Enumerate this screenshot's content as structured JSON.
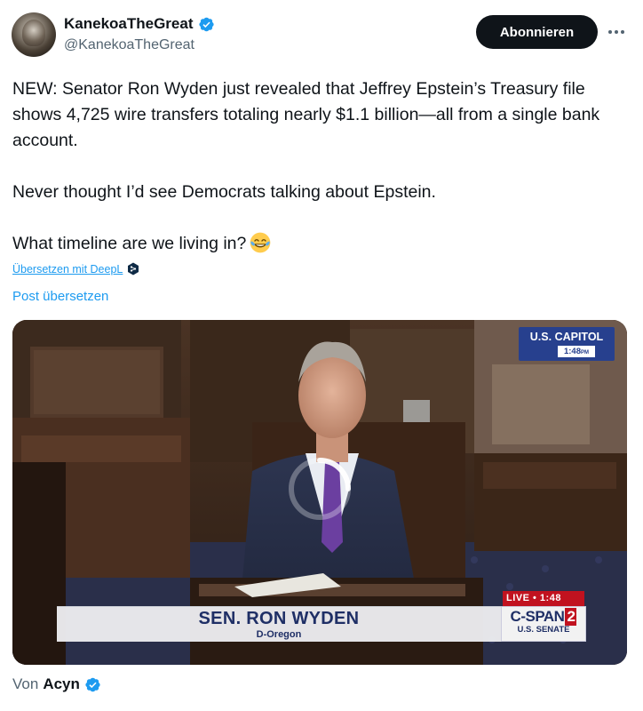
{
  "author": {
    "display_name": "KanekoaTheGreat",
    "handle": "@KanekoaTheGreat"
  },
  "actions": {
    "follow_label": "Abonnieren"
  },
  "tweet": {
    "paragraphs": [
      "NEW: Senator Ron Wyden just revealed that Jeffrey Epstein’s Treasury file shows 4,725 wire transfers totaling nearly $1.1 billion—all from a single bank account.",
      "Never thought I’d see Democrats talking about Epstein.",
      "What timeline are we living in?"
    ],
    "emoji": "face-with-tears-of-joy"
  },
  "translation": {
    "deepl_label": "Übersetzen mit DeepL",
    "post_translate_label": "Post übersetzen"
  },
  "video": {
    "location_badge": "U.S. CAPITOL",
    "badge_time": "1:48",
    "badge_time_suffix": "PM",
    "lower_third_name": "SEN. RON WYDEN",
    "lower_third_party": "D-Oregon",
    "live_label": "LIVE",
    "live_time": "1:48",
    "network_logo": "C-SPAN",
    "network_number": "2",
    "network_sub": "U.S. SENATE"
  },
  "attribution": {
    "prefix": "Von",
    "name": "Acyn"
  },
  "colors": {
    "verified_blue": "#1d9bf0",
    "link_blue": "#1d9bf0",
    "cspan_blue": "#1f2f66",
    "live_red": "#c1121f"
  }
}
